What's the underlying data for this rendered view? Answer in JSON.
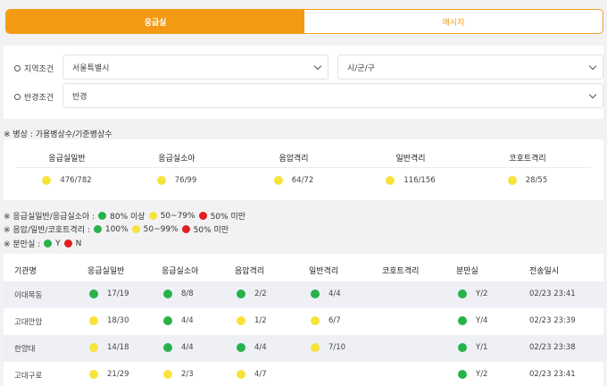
{
  "tabs": {
    "emergency": "응급실",
    "message": "메시지"
  },
  "filters": {
    "region_label": "지역조건",
    "region_value": "서울특별시",
    "district_value": "시/군/구",
    "radius_label": "반경조건",
    "radius_value": "반경"
  },
  "beds": {
    "title": "※ 병상 : 가용병상수/기준병상수",
    "columns": [
      {
        "label": "응급실일반",
        "value": "476/782",
        "status": "yellow"
      },
      {
        "label": "응급실소아",
        "value": "76/99",
        "status": "yellow"
      },
      {
        "label": "음압격리",
        "value": "64/72",
        "status": "yellow"
      },
      {
        "label": "일반격리",
        "value": "116/156",
        "status": "yellow"
      },
      {
        "label": "코호트격리",
        "value": "28/55",
        "status": "yellow"
      }
    ]
  },
  "legend": {
    "line1": {
      "prefix": "※ 응급실일반/응급실소아 :",
      "green": "80% 이상",
      "yellow": "50~79%",
      "red": "50% 미만"
    },
    "line2": {
      "prefix": "※ 음압/일반/코호트격리 :",
      "green": "100%",
      "yellow": "50~99%",
      "red": "50% 미만"
    },
    "line3": {
      "prefix": "※ 분만실 :",
      "green": "Y",
      "red": "N"
    }
  },
  "colors": {
    "green": "#27b24a",
    "yellow": "#f7e33a",
    "red": "#e51e1e",
    "accent": "#f49a12"
  },
  "table": {
    "headers": [
      "기관명",
      "응급실일반",
      "응급실소아",
      "음압격리",
      "일반격리",
      "코호트격리",
      "분만실",
      "전송일시"
    ],
    "rows": [
      {
        "name": "이대목동",
        "er": {
          "c": "green",
          "v": "17/19"
        },
        "child": {
          "c": "green",
          "v": "8/8"
        },
        "neg": {
          "c": "green",
          "v": "2/2"
        },
        "iso": {
          "c": "green",
          "v": "4/4"
        },
        "cohort": null,
        "birth": {
          "c": "green",
          "v": "Y/2"
        },
        "time": "02/23 23:41"
      },
      {
        "name": "고대안암",
        "er": {
          "c": "yellow",
          "v": "18/30"
        },
        "child": {
          "c": "green",
          "v": "4/4"
        },
        "neg": {
          "c": "yellow",
          "v": "1/2"
        },
        "iso": {
          "c": "yellow",
          "v": "6/7"
        },
        "cohort": null,
        "birth": {
          "c": "green",
          "v": "Y/4"
        },
        "time": "02/23 23:39"
      },
      {
        "name": "한양대",
        "er": {
          "c": "yellow",
          "v": "14/18"
        },
        "child": {
          "c": "green",
          "v": "4/4"
        },
        "neg": {
          "c": "green",
          "v": "4/4"
        },
        "iso": {
          "c": "yellow",
          "v": "7/10"
        },
        "cohort": null,
        "birth": {
          "c": "green",
          "v": "Y/1"
        },
        "time": "02/23 23:38"
      },
      {
        "name": "고대구로",
        "er": {
          "c": "yellow",
          "v": "21/29"
        },
        "child": {
          "c": "yellow",
          "v": "2/3"
        },
        "neg": {
          "c": "yellow",
          "v": "4/7"
        },
        "iso": null,
        "cohort": null,
        "birth": {
          "c": "green",
          "v": "Y/2"
        },
        "time": "02/23 23:41"
      }
    ]
  }
}
